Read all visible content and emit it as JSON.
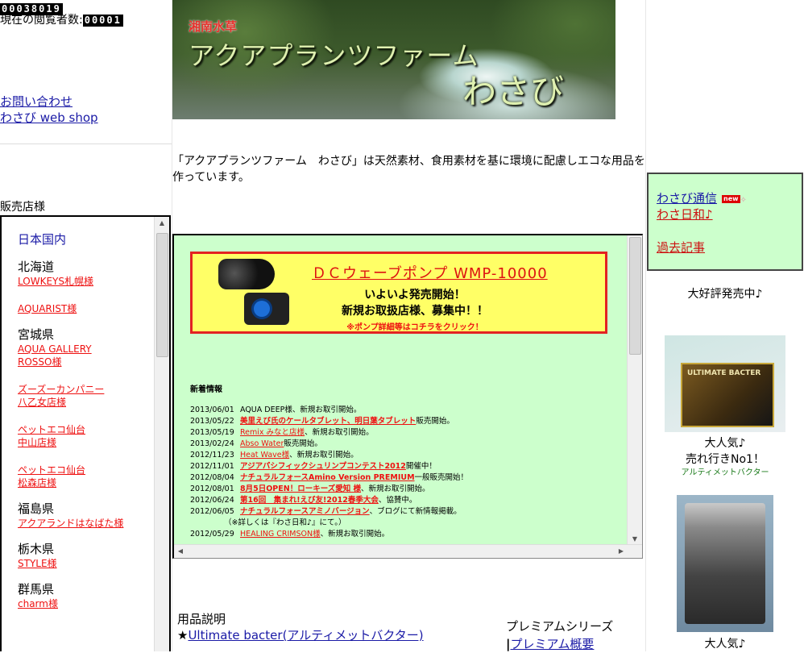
{
  "counter": {
    "total": "00038019",
    "viewers_label": "現在の閲覧者数:",
    "viewers": "00001"
  },
  "left_links": {
    "contact": "お問い合わせ",
    "webshop": "わさび web shop"
  },
  "shops": {
    "title": "販売店様",
    "japan": "日本国内",
    "regions": [
      {
        "region": "北海道",
        "stores": [
          [
            "LOWKEYS札幌様"
          ],
          [
            "AQUARIST様"
          ]
        ]
      },
      {
        "region": "宮城県",
        "stores": [
          [
            "AQUA GALLERY",
            "ROSSO様"
          ],
          [
            "ズーズーカンパニー",
            "八乙女店様"
          ],
          [
            "ペットエコ仙台",
            "中山店様"
          ],
          [
            "ペットエコ仙台",
            "松森店様"
          ]
        ]
      },
      {
        "region": "福島県",
        "stores": [
          [
            "アクアランドはなばた様"
          ]
        ]
      },
      {
        "region": "栃木県",
        "stores": [
          [
            "STYLE様"
          ]
        ]
      },
      {
        "region": "群馬県",
        "stores": [
          [
            "charm様"
          ]
        ]
      }
    ]
  },
  "banner": {
    "small": "湘南水草",
    "big": "アクアプランツファーム",
    "name": "わさび"
  },
  "intro": "「アクアプランツファーム　わさび」は天然素材、食用素材を基に環境に配慮しエコな用品を作っています。",
  "pump": {
    "title": "ＤＣウェーブポンプ WMP-10000",
    "line1": "いよいよ発売開始！",
    "line2": "新規お取扱店様、募集中！！",
    "line3": "※ポンプ詳細等はコチラをクリック！"
  },
  "news": {
    "title": "新着情報",
    "items": [
      {
        "date": "2013/06/01",
        "link": "",
        "text": "AQUA DEEP様、新規お取引開始。"
      },
      {
        "date": "2013/05/22",
        "link": "美里えび氏のケールタブレット、明日葉タブレット",
        "text": "販売開始。",
        "bold": true
      },
      {
        "date": "2013/05/19",
        "link": "Remix みなと店様",
        "text": "、新規お取引開始。"
      },
      {
        "date": "2013/02/24",
        "link": "Abso Water",
        "text": "販売開始。"
      },
      {
        "date": "2012/11/23",
        "link": "Heat Wave様",
        "text": "、新規お取引開始。"
      },
      {
        "date": "2012/11/01",
        "link": "アジアパシフィックシュリンプコンテスト2012",
        "text": "開催中！",
        "bold": true
      },
      {
        "date": "2012/08/04",
        "link": "ナチュラルフォースAmino Version PREMIUM",
        "text": "一般販売開始！",
        "bold": true
      },
      {
        "date": "2012/08/01",
        "link": "8月5日OPEN！ローキーズ愛知 様",
        "text": "、新規お取引開始。",
        "bold": true
      },
      {
        "date": "2012/06/24",
        "link": "第16回　集まれ!えび友!2012春季大会",
        "text": "、協賛中。",
        "bold": true
      },
      {
        "date": "2012/06/05",
        "link": "ナチュラルフォースアミノバージョン",
        "text": "、ブログにて新情報掲載。",
        "bold": true
      },
      {
        "date": "",
        "link": "",
        "text": "（※詳しくは『わさ日和♪』にて。）"
      },
      {
        "date": "2012/05/29",
        "link": "HEALING CRIMSON様",
        "text": "、新規お取引開始。"
      }
    ]
  },
  "usage": {
    "title": "用品説明",
    "item1": "Ultimate bacter(アルティメットバクター)"
  },
  "premium": {
    "title": "プレミアムシリーズ",
    "link": "プレミアム概要"
  },
  "right": {
    "links": {
      "tsushin": "わさび通信",
      "new_badge": "new",
      "biyori": "わさ日和♪",
      "past": "過去記事"
    },
    "hot": "大好評発売中♪",
    "prod1_label": "ULTIMATE BACTER",
    "cap1_line1": "大人気♪",
    "cap1_line2": "売れ行きNo1！",
    "cap1_small": "アルティメットバクター",
    "cap2": "大人気♪"
  }
}
